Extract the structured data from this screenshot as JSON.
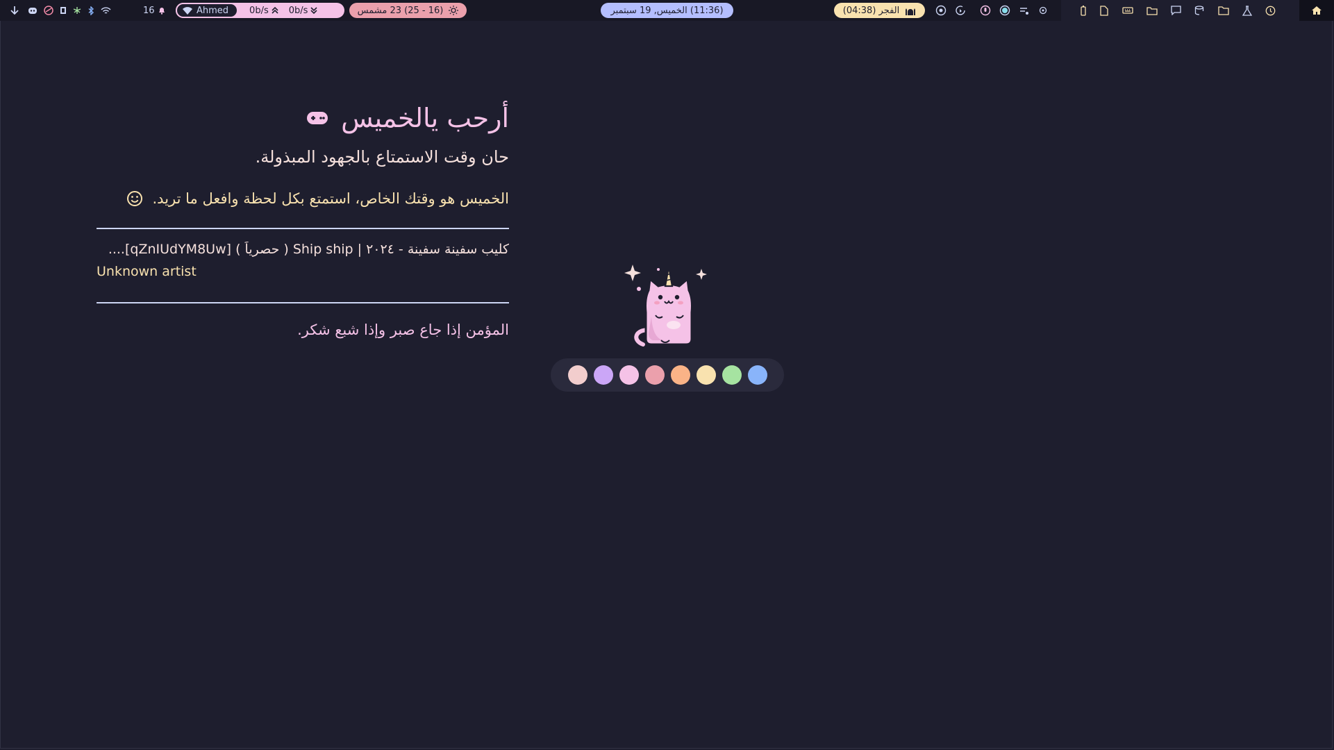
{
  "topbar": {
    "left_icons": [
      "arrow-down-icon",
      "discord-icon",
      "steam-icon",
      "screen-icon",
      "network-icon",
      "bluetooth-icon",
      "wifi-icon"
    ],
    "notification_count": "16",
    "network": {
      "user": "Ahmed",
      "upload": "0b/s",
      "download": "0b/s"
    },
    "weather": "(16 - 25) 23 مشمس",
    "center_date": "(11:36) الخميس, 19 سبتمبر",
    "prayer": "الفجر (04:38)",
    "tray_icons": [
      "settings-icon",
      "refresh-icon",
      "mic-icon",
      "circle-icon",
      "music-icon",
      "dot-icon"
    ],
    "launcher_icons": [
      "battery-icon",
      "file-icon",
      "keyboard-icon",
      "folder-open-icon",
      "chat-icon",
      "database-icon",
      "folder-icon",
      "flask-icon",
      "clock-icon",
      "home-icon"
    ]
  },
  "main": {
    "greeting": "أرحب يالخميس",
    "subtitle": "حان وقت الاستمتاع بالجهود المبذولة.",
    "message": "الخميس هو وقتك الخاص، استمتع بكل لحظة وافعل ما تريد.",
    "song_title": "كليب سفينة سفينة - ٢٠٢٤ | Ship ship ( حصرياً ) [qZnIUdYM8Uw]....",
    "artist": "Unknown artist",
    "quote": "المؤمن إذا جاع صبر وإذا شبع شكر."
  },
  "palette": [
    "#f2cdcd",
    "#cba6f7",
    "#f5c2e7",
    "#eba0ac",
    "#fab387",
    "#f9e2af",
    "#a6e3a1",
    "#89b4fa"
  ],
  "colors": {
    "background": "#1e1e2e",
    "pink": "#f5c2e7",
    "yellow": "#f9e2af",
    "lavender": "#b4befe"
  }
}
